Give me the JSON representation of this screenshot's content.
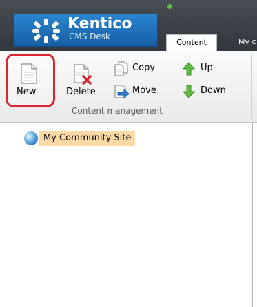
{
  "header": {
    "logo_title": "Kentico",
    "logo_subtitle": "CMS Desk",
    "tabs": [
      {
        "label": "Content"
      },
      {
        "label": "My c"
      }
    ]
  },
  "ribbon": {
    "buttons": {
      "new": "New",
      "delete": "Delete",
      "copy": "Copy",
      "move": "Move",
      "up": "Up",
      "down": "Down"
    },
    "group_label": "Content management"
  },
  "tree": {
    "root_label": "My Community Site",
    "status_color": "#58c23f",
    "selected_bg": "#fcd9a5"
  },
  "colors": {
    "header_bg": "#3a3f45",
    "logo_blue": "#1f6fb8",
    "highlight_red": "#d9262f"
  }
}
